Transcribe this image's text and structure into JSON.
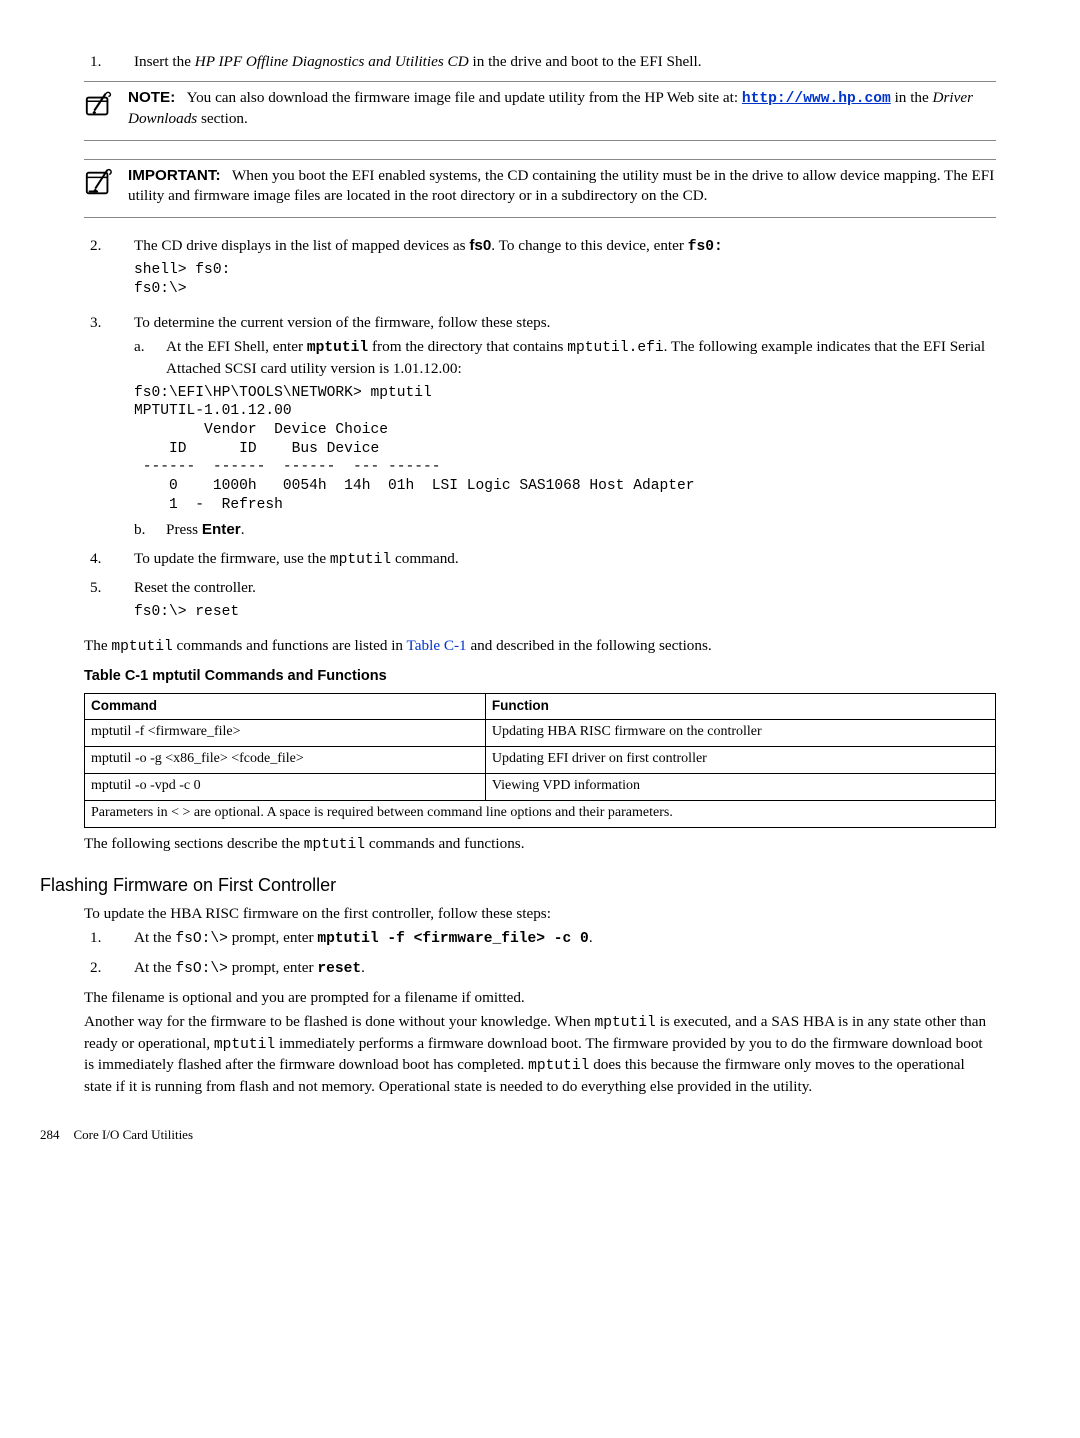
{
  "step1": {
    "num": "1.",
    "text_a": "Insert the ",
    "text_b": "HP IPF Offline Diagnostics and Utilities CD",
    "text_c": " in the drive and boot to the EFI Shell."
  },
  "note1": {
    "label": "NOTE:",
    "text_a": "You can also download the firmware image file and update utility from the HP Web site at: ",
    "link": "http://www.hp.com",
    "text_b": " in the ",
    "text_c": "Driver Downloads",
    "text_d": " section."
  },
  "important1": {
    "label": "IMPORTANT:",
    "text": "When you boot the EFI enabled systems, the CD containing the utility must be in the drive to allow device mapping. The EFI utility and firmware image files are located in the root directory or in a subdirectory on the CD."
  },
  "step2": {
    "num": "2.",
    "text_a": "The CD drive displays in the list of mapped devices as ",
    "fs0": "fs0",
    "text_b": ". To change to this device, enter ",
    "cmd": "fs0:",
    "code": "shell> fs0:\nfs0:\\>"
  },
  "step3": {
    "num": "3.",
    "text": "To determine the current version of the firmware, follow these steps.",
    "a_letter": "a.",
    "a_text_1": "At the EFI Shell, enter ",
    "a_cmd": "mptutil",
    "a_text_2": " from the directory that contains ",
    "a_mono": "mptutil.efi",
    "a_text_3": ". The following example indicates that the EFI Serial Attached SCSI card utility version is 1.01.12.00:",
    "a_code": "fs0:\\EFI\\HP\\TOOLS\\NETWORK> mptutil\nMPTUTIL-1.01.12.00\n        Vendor  Device Choice\n    ID      ID    Bus Device\n ------  ------  ------  --- ------\n    0    1000h   0054h  14h  01h  LSI Logic SAS1068 Host Adapter\n    1  -  Refresh",
    "b_letter": "b.",
    "b_text_1": "Press ",
    "b_enter": "Enter",
    "b_text_2": "."
  },
  "step4": {
    "num": "4.",
    "text_a": "To update the firmware, use the ",
    "mono": "mptutil",
    "text_b": " command."
  },
  "step5": {
    "num": "5.",
    "text": "Reset the controller.",
    "code": "fs0:\\> reset"
  },
  "aftersteps": {
    "text_a": "The ",
    "mono": "mptutil",
    "text_b": " commands and functions are listed in ",
    "link": "Table C-1",
    "text_c": " and described in the following sections."
  },
  "table": {
    "caption": "Table  C-1  mptutil Commands and Functions",
    "h1": "Command",
    "h2": "Function",
    "r1c1": "mptutil -f <firmware_file>",
    "r1c2": "Updating HBA RISC firmware on the controller",
    "r2c1": "mptutil -o -g <x86_file> <fcode_file>",
    "r2c2": "Updating EFI driver on first controller",
    "r3c1": "mptutil -o -vpd -c 0",
    "r3c2": "Viewing VPD information",
    "footnote": "Parameters in < > are optional. A space is required between command line options and their parameters."
  },
  "aftertable": {
    "text_a": "The following sections describe the ",
    "mono": "mptutil",
    "text_b": " commands and functions."
  },
  "section": {
    "heading": "Flashing Firmware on First Controller",
    "lead": "To update the HBA RISC firmware on the first controller, follow these steps:",
    "s1_num": "1.",
    "s1_a": "At the ",
    "s1_mono1": "fsO:\\>",
    "s1_b": " prompt, enter ",
    "s1_cmd": "mptutil -f <firmware_file> -c 0",
    "s1_c": ".",
    "s2_num": "2.",
    "s2_a": "At the ",
    "s2_mono1": "fsO:\\>",
    "s2_b": " prompt, enter ",
    "s2_cmd": "reset",
    "s2_c": ".",
    "p1": "The filename is optional and you are prompted for a filename if omitted.",
    "p2_a": "Another way for the firmware to be flashed is done without your knowledge. When ",
    "p2_m1": "mptutil",
    "p2_b": " is executed, and a SAS HBA is in any state other than ready or operational, ",
    "p2_m2": "mptutil",
    "p2_c": " immediately performs a firmware download boot. The firmware provided by you to do the firmware download boot is immediately flashed after the firmware download boot has completed. ",
    "p2_m3": "mptutil",
    "p2_d": " does this because the firmware only moves to the operational state if it is running from flash and not memory. Operational state is needed to do everything else provided in the utility."
  },
  "footer": {
    "pagenum": "284",
    "title": "Core I/O Card Utilities"
  }
}
